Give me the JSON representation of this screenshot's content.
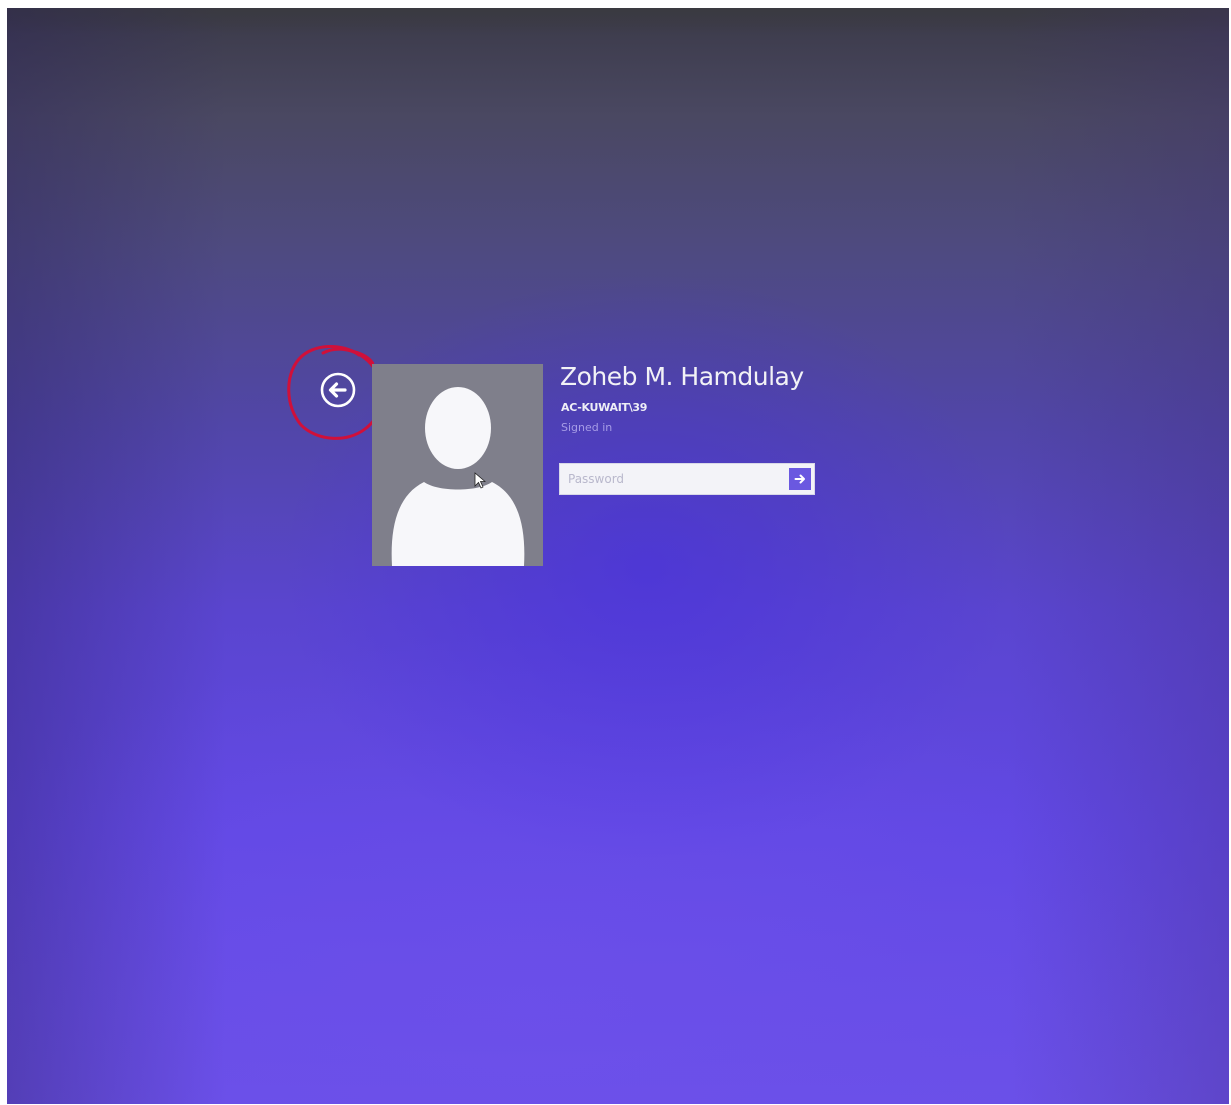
{
  "lock_screen": {
    "user": {
      "display_name": "Zoheb M. Hamdulay",
      "account": "AC-KUWAIT\\39",
      "status": "Signed in"
    },
    "password_field": {
      "placeholder": "Password"
    },
    "icons": {
      "back": "back-arrow-circle-icon",
      "submit": "arrow-right-icon",
      "avatar": "user-silhouette-icon"
    },
    "colors": {
      "background": "#5a45cf",
      "annotation": "#d0103a",
      "submit_button": "#6a58e0",
      "status_text": "#a69ce6"
    }
  }
}
